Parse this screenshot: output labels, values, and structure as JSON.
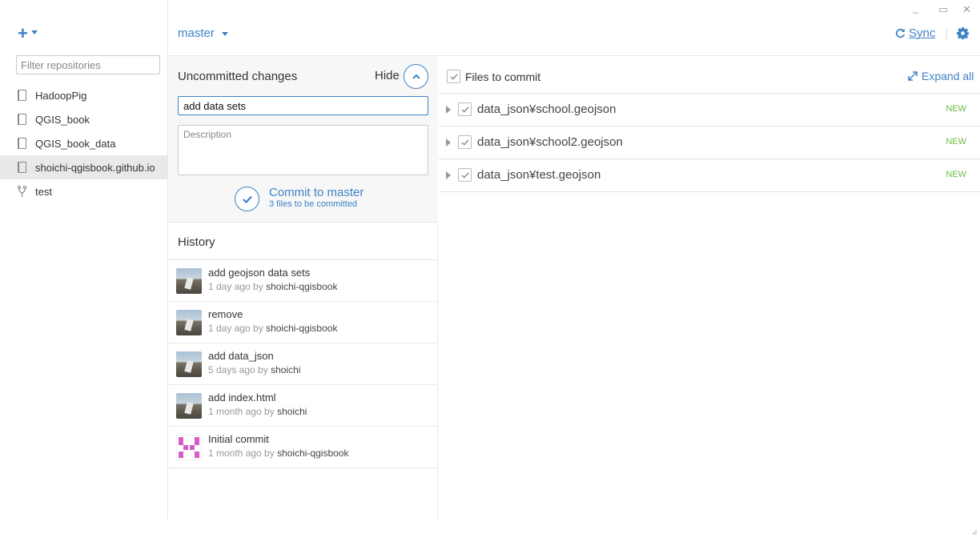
{
  "window": {
    "minimize": "_",
    "maximize": "▭",
    "close": "✕"
  },
  "sidebar": {
    "filter_placeholder": "Filter repositories",
    "repos": [
      {
        "label": "HadoopPig",
        "icon": "book-icon"
      },
      {
        "label": "QGIS_book",
        "icon": "book-icon"
      },
      {
        "label": "QGIS_book_data",
        "icon": "book-icon"
      },
      {
        "label": "shoichi-qgisbook.github.io",
        "icon": "book-icon",
        "selected": true
      },
      {
        "label": "test",
        "icon": "fork-icon"
      }
    ]
  },
  "topbar": {
    "branch": "master",
    "sync_label": "Sync"
  },
  "commit": {
    "title": "Uncommitted changes",
    "hide_label": "Hide",
    "summary_value": "add data sets",
    "description_placeholder": "Description",
    "button_label": "Commit to master",
    "button_sub": "3 files to be committed"
  },
  "history": {
    "title": "History",
    "items": [
      {
        "message": "add geojson data sets",
        "when": "1 day ago by",
        "author": "shoichi-qgisbook",
        "avatar": "photo"
      },
      {
        "message": "remove",
        "when": "1 day ago by",
        "author": "shoichi-qgisbook",
        "avatar": "photo"
      },
      {
        "message": "add data_json",
        "when": "5 days ago by",
        "author": "shoichi",
        "avatar": "photo"
      },
      {
        "message": "add index.html",
        "when": "1 month ago by",
        "author": "shoichi",
        "avatar": "photo"
      },
      {
        "message": "Initial commit",
        "when": "1 month ago by",
        "author": "shoichi-qgisbook",
        "avatar": "identicon"
      }
    ]
  },
  "files": {
    "header_label": "Files to commit",
    "expand_all": "Expand all",
    "items": [
      {
        "name": "data_json¥school.geojson",
        "status": "NEW"
      },
      {
        "name": "data_json¥school2.geojson",
        "status": "NEW"
      },
      {
        "name": "data_json¥test.geojson",
        "status": "NEW"
      }
    ]
  },
  "colors": {
    "accent": "#3e82c4",
    "new_badge": "#6bbd46",
    "selected_row": "#e9e9e9"
  }
}
